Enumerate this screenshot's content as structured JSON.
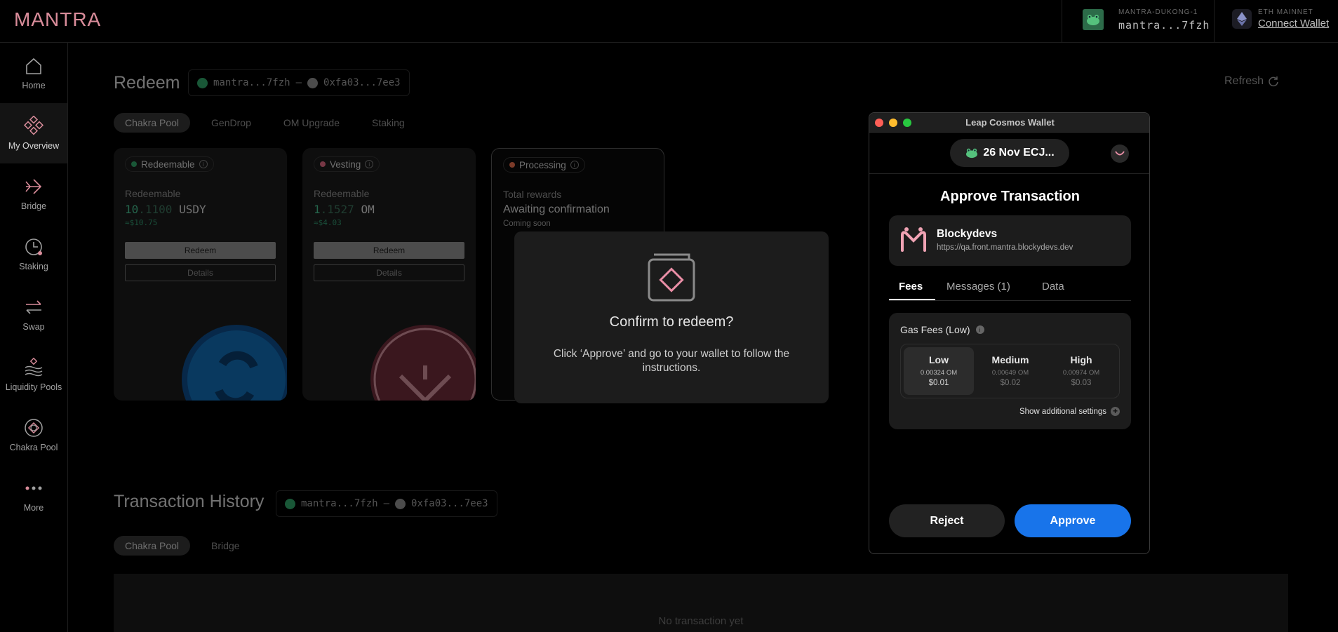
{
  "header": {
    "logo": "MANTRA",
    "account_chain": "MANTRA-DUKONG-1",
    "account_address": "mantra...7fzh",
    "eth_network": "ETH MAINNET",
    "connect_wallet": "Connect Wallet"
  },
  "sidebar": {
    "items": [
      {
        "label": "Home",
        "icon": "home-icon"
      },
      {
        "label": "My Overview",
        "icon": "overview-icon",
        "active": true
      },
      {
        "label": "Bridge",
        "icon": "bridge-icon"
      },
      {
        "label": "Staking",
        "icon": "staking-icon"
      },
      {
        "label": "Swap",
        "icon": "swap-icon"
      },
      {
        "label": "Liquidity Pools",
        "icon": "liquidity-icon"
      },
      {
        "label": "Chakra Pool",
        "icon": "chakra-icon"
      },
      {
        "label": "More",
        "icon": "more-icon"
      }
    ]
  },
  "redeem": {
    "title": "Redeem",
    "address_from": "mantra...7fzh",
    "separator": "—",
    "address_to": "0xfa03...7ee3",
    "refresh": "Refresh",
    "tabs": [
      "Chakra Pool",
      "GenDrop",
      "OM Upgrade",
      "Staking"
    ],
    "cards": [
      {
        "status": "Redeemable",
        "label": "Redeemable",
        "amount_int": "10",
        "amount_frac": ".1100",
        "unit": "USDY",
        "usd": "≈$10.75",
        "redeem": "Redeem",
        "details": "Details"
      },
      {
        "status": "Vesting",
        "label": "Redeemable",
        "amount_int": "1",
        "amount_frac": ".1527",
        "unit": "OM",
        "usd": "≈$4.03",
        "redeem": "Redeem",
        "details": "Details"
      },
      {
        "status": "Processing",
        "label": "Total rewards",
        "awaiting": "Awaiting confirmation",
        "soon": "Coming soon"
      }
    ]
  },
  "modal": {
    "title": "Confirm to redeem?",
    "text": "Click ‘Approve’ and go to your wallet to follow the instructions."
  },
  "history": {
    "title": "Transaction History",
    "address_from": "mantra...7fzh",
    "separator": "—",
    "address_to": "0xfa03...7ee3",
    "tabs": [
      "Chakra Pool",
      "Bridge"
    ],
    "empty": "No transaction yet"
  },
  "wallet": {
    "window_title": "Leap Cosmos Wallet",
    "account": "26 Nov ECJ...",
    "heading": "Approve Transaction",
    "dapp_name": "Blockydevs",
    "dapp_url": "https://qa.front.mantra.blockydevs.dev",
    "tabs": [
      "Fees",
      "Messages (1)",
      "Data"
    ],
    "gas_label": "Gas Fees (Low)",
    "options": [
      {
        "name": "Low",
        "om": "0.00324 OM",
        "usd": "$0.01",
        "selected": true
      },
      {
        "name": "Medium",
        "om": "0.00649 OM",
        "usd": "$0.02"
      },
      {
        "name": "High",
        "om": "0.00974 OM",
        "usd": "$0.03"
      }
    ],
    "additional": "Show additional settings",
    "reject": "Reject",
    "approve": "Approve"
  },
  "colors": {
    "accent_pink": "#d98c9a",
    "approve_blue": "#1874ea",
    "green": "#2f9e65"
  }
}
